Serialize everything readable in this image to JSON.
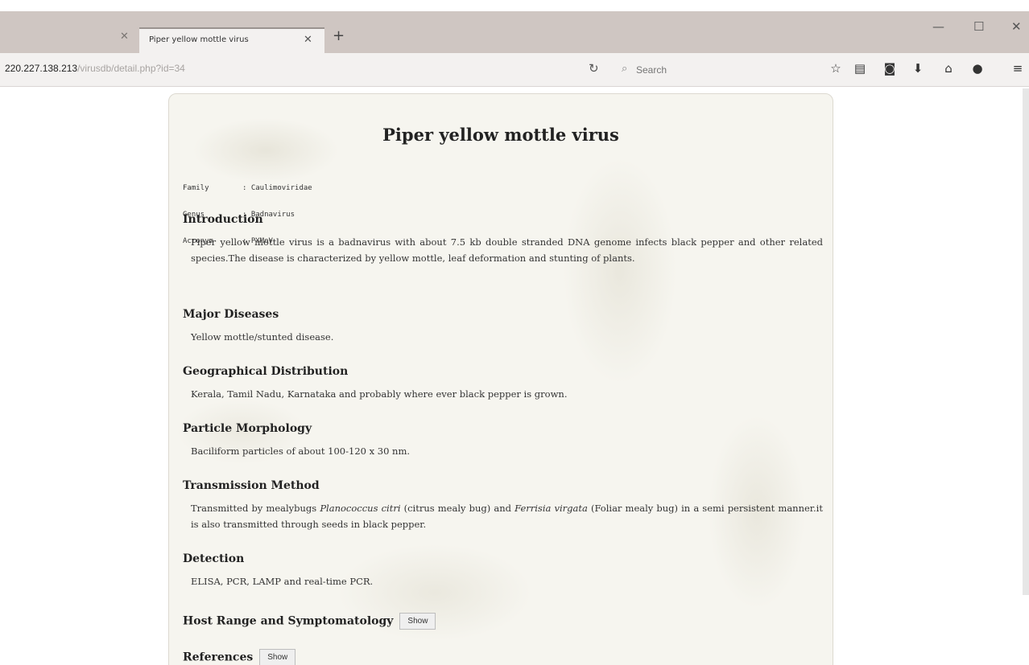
{
  "browser": {
    "tab_title": "Piper yellow mottle virus",
    "url_host": "220.227.138.213",
    "url_path": "/virusdb/detail.php?id=34",
    "search_placeholder": "Search",
    "icons": [
      "close-icon",
      "plus-icon",
      "minimize-icon",
      "maximize-icon",
      "window-close-icon",
      "reload-icon",
      "search-icon",
      "bookmark-star-icon",
      "reading-list-icon",
      "pocket-icon",
      "download-icon",
      "home-icon",
      "chat-icon",
      "menu-icon"
    ]
  },
  "page": {
    "title": "Piper yellow mottle virus",
    "meta": [
      {
        "key": "Family",
        "value": ": Caulimoviridae"
      },
      {
        "key": "Genus",
        "value": ": Badnavirus"
      },
      {
        "key": "Acronym",
        "value": ": PYMoV"
      }
    ],
    "sections": {
      "introduction": {
        "heading": "Introduction",
        "text": "Piper yellow mottle virus is a badnavirus with about 7.5 kb double stranded DNA genome infects black pepper and other related species.The disease is characterized by yellow mottle, leaf deformation and stunting of plants."
      },
      "major_diseases": {
        "heading": "Major Diseases",
        "text": "Yellow mottle/stunted disease."
      },
      "geographical_distribution": {
        "heading": "Geographical Distribution",
        "text": "Kerala, Tamil Nadu, Karnataka and probably where ever black pepper is grown."
      },
      "particle_morphology": {
        "heading": "Particle Morphology",
        "text": "Baciliform particles of about 100-120 x 30 nm."
      },
      "transmission_method": {
        "heading": "Transmission Method",
        "text_part1": "Transmitted by mealybugs ",
        "species1": "Planococcus citri",
        "text_part2": " (citrus mealy bug) and ",
        "species2": "Ferrisia virgata",
        "text_part3": " (Foliar mealy bug) in a semi persistent manner.it is also transmitted through seeds in black pepper."
      },
      "detection": {
        "heading": "Detection",
        "text": "ELISA, PCR, LAMP and real-time PCR."
      },
      "host_range": {
        "heading": "Host Range and Symptomatology",
        "button": "Show"
      },
      "references": {
        "heading": "References",
        "button": "Show"
      }
    }
  },
  "colors": {
    "tab_strip": "#cfc6c2",
    "toolbar": "#f3f1f0",
    "card_background": "#f6f5ef"
  }
}
